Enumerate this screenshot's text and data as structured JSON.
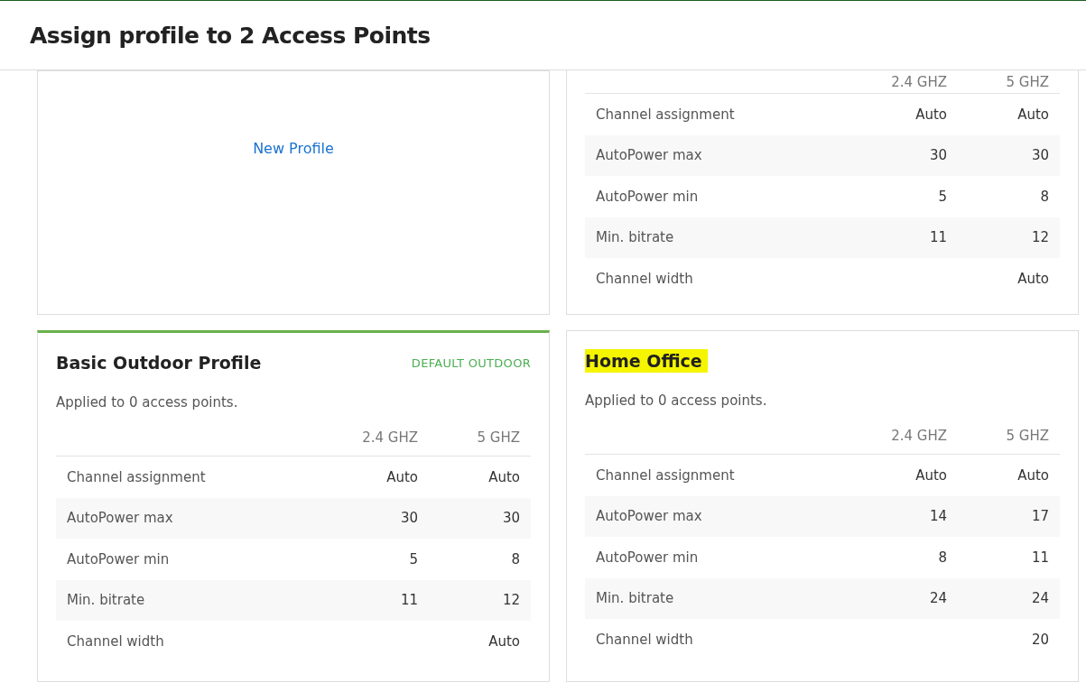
{
  "header": {
    "title": "Assign profile to 2 Access Points"
  },
  "new_profile_card": {
    "link": "New Profile",
    "selected": false
  },
  "profiles": [
    {
      "columns": [
        "2.4 GHZ",
        "5 GHZ"
      ],
      "rows": [
        {
          "label": "Channel assignment",
          "value_1": "Auto",
          "value_2": "Auto"
        },
        {
          "label": "AutoPower max",
          "value_1": "30",
          "value_2": "30"
        },
        {
          "label": "AutoPower min",
          "value_1": "5",
          "value_2": "8"
        },
        {
          "label": "Min. bitrate",
          "value_1": "11",
          "value_2": "12"
        },
        {
          "label": "Channel width",
          "value_2": "Auto"
        }
      ]
    },
    {
      "title": "Basic Outdoor Profile",
      "highlighted": false,
      "badge": "DEFAULT OUTDOOR",
      "applied": "Applied to 0 access points.",
      "selected": true,
      "columns": [
        "2.4 GHZ",
        "5 GHZ"
      ],
      "rows": [
        {
          "label": "Channel assignment",
          "value_1": "Auto",
          "value_2": "Auto"
        },
        {
          "label": "AutoPower max",
          "value_1": "30",
          "value_2": "30"
        },
        {
          "label": "AutoPower min",
          "value_1": "5",
          "value_2": "8"
        },
        {
          "label": "Min. bitrate",
          "value_1": "11",
          "value_2": "12"
        },
        {
          "label": "Channel width",
          "value_2": "Auto"
        }
      ]
    },
    {
      "title": "Home Office",
      "highlighted": true,
      "applied": "Applied to 0 access points.",
      "selected": false,
      "columns": [
        "2.4 GHZ",
        "5 GHZ"
      ],
      "rows": [
        {
          "label": "Channel assignment",
          "value_1": "Auto",
          "value_2": "Auto"
        },
        {
          "label": "AutoPower max",
          "value_1": "14",
          "value_2": "17"
        },
        {
          "label": "AutoPower min",
          "value_1": "8",
          "value_2": "11"
        },
        {
          "label": "Min. bitrate",
          "value_1": "24",
          "value_2": "24"
        },
        {
          "label": "Channel width",
          "value_2": "20"
        }
      ]
    }
  ]
}
